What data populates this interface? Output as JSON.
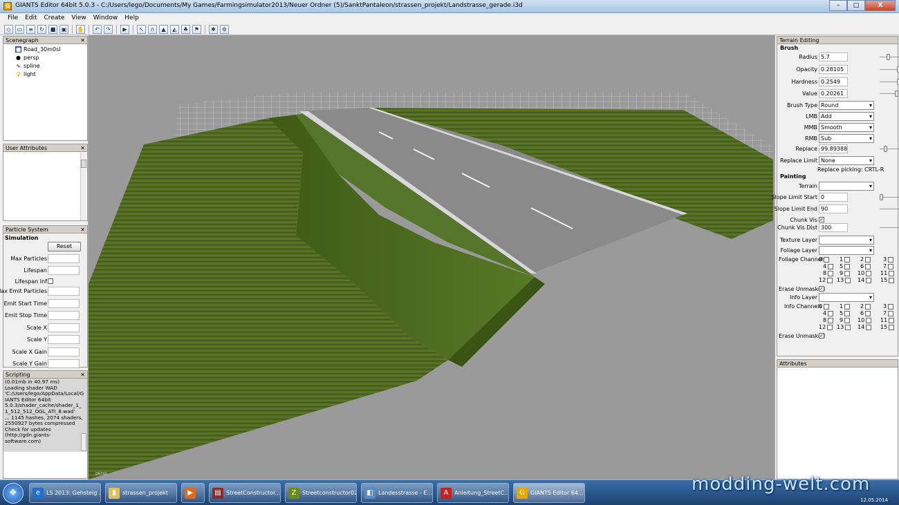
{
  "window": {
    "title": "GIANTS Editor 64bit 5.0.3 - C:/Users/lego/Documents/My Games/Farmingsimulator2013/Neuer Ordner (5)/SanktPantaleon/strassen_projekt/Landstrasse_gerade.i3d",
    "min": "–",
    "max": "□",
    "close": "X"
  },
  "menu": [
    "File",
    "Edit",
    "Create",
    "View",
    "Window",
    "Help"
  ],
  "scenegraph": {
    "title": "Scenegraph",
    "items": [
      "Road_30m0sl",
      "persp",
      "spline",
      "light"
    ]
  },
  "user_attributes": {
    "title": "User Attributes"
  },
  "particle": {
    "title": "Particle System",
    "section": "Simulation",
    "reset": "Reset",
    "fields": [
      "Max Particles",
      "Lifespan",
      "Lifespan Inf",
      "Max Emit Particles",
      "Emit Start Time",
      "Emit Stop Time",
      "Scale X",
      "Scale Y",
      "Scale X Gain",
      "Scale Y Gain"
    ]
  },
  "scripting": {
    "title": "Scripting",
    "lines": [
      "(0.01mb in 40.97 ms)",
      "Loading shader WAD",
      "'C:/Users/lego/AppData/Local/G",
      "IANTS Editor 64bit",
      "5.0.3/shader_cache/shader_1_",
      "1_512_512_OGL_ATI_8.wad'",
      "... 1145 hashes, 2074 shaders,",
      "2550927 bytes compressed",
      "Check for updates",
      "(http://gdn.giants-",
      "software.com)"
    ]
  },
  "viewport": {
    "camera_label": "persp"
  },
  "terrain": {
    "title": "Terrain Editing",
    "brush_section": "Brush",
    "radius": {
      "label": "Radius",
      "value": "5.7",
      "level": 0.35
    },
    "opacity": {
      "label": "Opacity",
      "value": "0.28105",
      "level": 0.28
    },
    "hardness": {
      "label": "Hardness",
      "value": "0.2549",
      "level": 0.25
    },
    "value": {
      "label": "Value",
      "value": "0.20261",
      "level": 0.2
    },
    "brush_type": {
      "label": "Brush Type",
      "value": "Round"
    },
    "lmb": {
      "label": "LMB",
      "value": "Add"
    },
    "mmb": {
      "label": "MMB",
      "value": "Smooth"
    },
    "rmb": {
      "label": "RMB",
      "value": "Sub"
    },
    "replace": {
      "label": "Replace",
      "value": "99.89388",
      "level": 0.9
    },
    "replace_limit": {
      "label": "Replace Limit",
      "value": "None"
    },
    "replace_picking": "Replace picking: CRTL-R",
    "painting_section": "Painting",
    "terrain": {
      "label": "Terrain",
      "value": ""
    },
    "slope_start": {
      "label": "Slope Limit Start",
      "value": "0"
    },
    "slope_end": {
      "label": "Slope Limit End",
      "value": "90"
    },
    "chunk_vis": {
      "label": "Chunk Vis",
      "checked": "✓"
    },
    "chunk_vis_dist": {
      "label": "Chunk Vis Dist",
      "value": "300"
    },
    "texture_layer": {
      "label": "Texture Layer",
      "value": ""
    },
    "foliage_layer": {
      "label": "Foliage Layer",
      "value": ""
    },
    "foliage_channels": {
      "label": "Foliage Channels"
    },
    "erase_unmasked_1": {
      "label": "Erase Unmasked",
      "checked": "✓"
    },
    "info_layer": {
      "label": "Info Layer",
      "value": ""
    },
    "info_channels": {
      "label": "Info Channels"
    },
    "erase_unmasked_2": {
      "label": "Erase Unmasked",
      "checked": "✓"
    },
    "channel_numbers": [
      "0",
      "1",
      "2",
      "3",
      "4",
      "5",
      "6",
      "7",
      "8",
      "9",
      "10",
      "11",
      "12",
      "13",
      "14",
      "15"
    ]
  },
  "attributes": {
    "title": "Attributes"
  },
  "taskbar": {
    "tasks": [
      {
        "label": "LS 2013: Gehsteig ...",
        "color": "#1f6fd0",
        "glyph": "e"
      },
      {
        "label": "strassen_projekt",
        "color": "#e3c15a",
        "glyph": "▮"
      },
      {
        "label": "",
        "color": "#e06a1a",
        "glyph": "▶"
      },
      {
        "label": "StreetConstructor...",
        "color": "#8a2a2a",
        "glyph": "▤"
      },
      {
        "label": "Streetconstructor02",
        "color": "#6a8a1a",
        "glyph": "Z"
      },
      {
        "label": "Landesstrasse - E...",
        "color": "#5a8ac8",
        "glyph": "◧"
      },
      {
        "label": "Anleitung_StreetC...",
        "color": "#c8201a",
        "glyph": "A"
      },
      {
        "label": "GIANTS Editor 64...",
        "color": "#e8a400",
        "glyph": "G"
      }
    ],
    "date": "12.05.2014"
  },
  "watermark": "modding-welt.com"
}
